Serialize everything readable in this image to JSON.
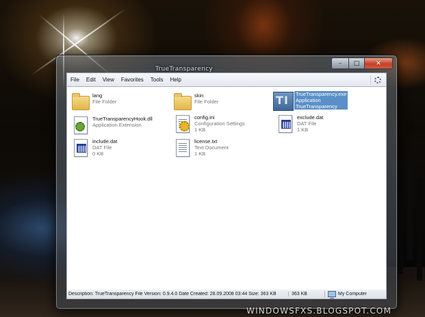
{
  "window": {
    "title": "TrueTransparency",
    "caption": {
      "minimize": "–",
      "maximize": "□",
      "close": "✕"
    }
  },
  "menu": [
    "File",
    "Edit",
    "View",
    "Favorites",
    "Tools",
    "Help"
  ],
  "files": [
    {
      "name": "lang",
      "type": "File Folder",
      "size": "",
      "icon": "folder-icon"
    },
    {
      "name": "skin",
      "type": "File Folder",
      "size": "",
      "icon": "folder-icon"
    },
    {
      "name": "TrueTransparency.exe",
      "type": "Application",
      "size": "TrueTransparency",
      "icon": "application-icon",
      "selected": true
    },
    {
      "name": "TrueTransparencyHook.dll",
      "type": "Application Extension",
      "size": "",
      "icon": "dll-icon"
    },
    {
      "name": "config.ini",
      "type": "Configuration Settings",
      "size": "1 KB",
      "icon": "settings-file-icon"
    },
    {
      "name": "exclude.dat",
      "type": "DAT File",
      "size": "1 KB",
      "icon": "dat-file-icon"
    },
    {
      "name": "include.dat",
      "type": "DAT File",
      "size": "0 KB",
      "icon": "dat-file-icon"
    },
    {
      "name": "license.txt",
      "type": "Text Document",
      "size": "1 KB",
      "icon": "text-document-icon"
    }
  ],
  "status": {
    "description": "Description: TrueTransparency File Version: 0.9.4.0 Date Created: 28.09.2008 03:44 Size: 363 KB",
    "size": "363 KB",
    "zone": "My Computer"
  },
  "watermark": "WINDOWSFXS.BLOGSPOT.COM"
}
